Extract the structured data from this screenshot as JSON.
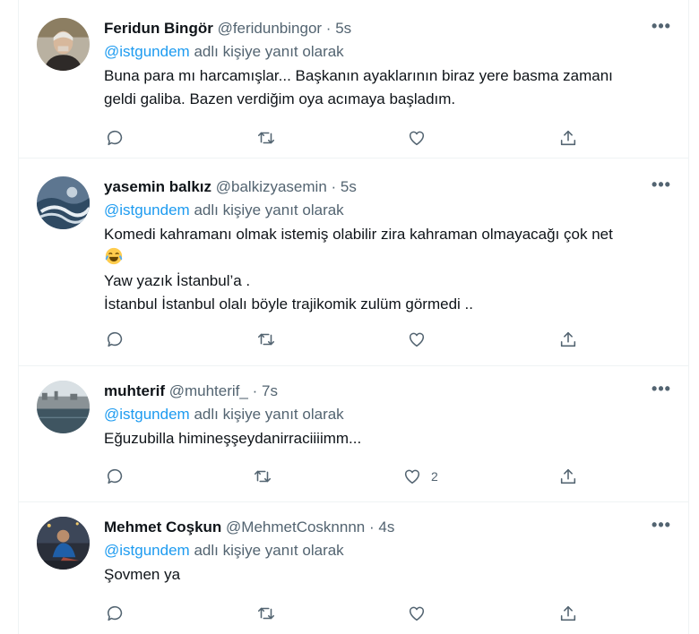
{
  "reply_prefix": "@istgundem",
  "reply_suffix": "adlı kişiye yanıt olarak",
  "more_label": "•••",
  "tweets": [
    {
      "name": "Feridun Bingör",
      "handle": "@feridunbingor",
      "dot": "·",
      "time": "5s",
      "lines": [
        "Buna para mı harcamışlar... Başkanın ayaklarının biraz yere basma zamanı",
        "geldi galiba. Bazen verdiğim oya acımaya başladım."
      ],
      "like_count": ""
    },
    {
      "name": "yasemin balkız",
      "handle": "@balkizyasemin",
      "dot": "·",
      "time": "5s",
      "lines": [
        "Komedi kahramanı olmak istemiş olabilir zira kahraman olmayacağı çok net",
        "",
        "Yaw yazık İstanbul’a .",
        "İstanbul İstanbul olalı böyle trajikomik zulüm görmedi .."
      ],
      "emoji": "face-with-tears-of-joy-emoji",
      "like_count": ""
    },
    {
      "name": "muhterif",
      "handle": "@muhterif_",
      "dot": "·",
      "time": "7s",
      "lines": [
        "Eğuzubilla himineşşeydanirraciiiimm..."
      ],
      "like_count": "2"
    },
    {
      "name": "Mehmet Coşkun",
      "handle": "@MehmetCosknnnn",
      "dot": "·",
      "time": "4s",
      "lines": [
        "Şovmen ya"
      ],
      "like_count": ""
    }
  ],
  "colors": {
    "accent": "#1d9bf0",
    "secondary_text": "#536471",
    "border": "#eff3f4"
  }
}
